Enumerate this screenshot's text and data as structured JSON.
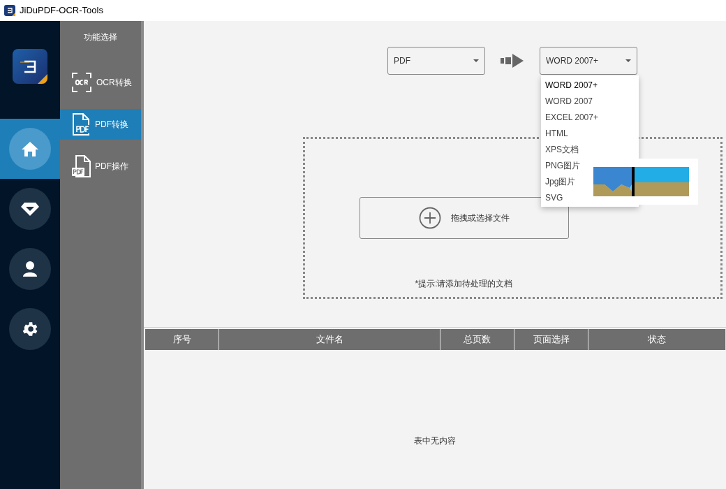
{
  "window": {
    "title": "JiDuPDF-OCR-Tools"
  },
  "nav": [
    {
      "kind": "home",
      "selected": true
    },
    {
      "kind": "diamond",
      "selected": false
    },
    {
      "kind": "user",
      "selected": false
    },
    {
      "kind": "settings",
      "selected": false
    }
  ],
  "sidebar": {
    "title": "功能选择",
    "items": [
      {
        "kind": "ocr",
        "label": "OCR转换",
        "selected": false
      },
      {
        "kind": "pdf",
        "label": "PDF转换",
        "selected": true
      },
      {
        "kind": "pdfdoc",
        "label": "PDF操作",
        "selected": false
      }
    ]
  },
  "source_select": {
    "value": "PDF"
  },
  "target_select": {
    "value": "WORD 2007+",
    "expanded": true,
    "options": [
      {
        "label": "WORD 2007+",
        "selected": true
      },
      {
        "label": "WORD 2007",
        "selected": false
      },
      {
        "label": "EXCEL 2007+",
        "selected": false
      },
      {
        "label": "HTML",
        "selected": false
      },
      {
        "label": "XPS文档",
        "selected": false
      },
      {
        "label": "PNG图片",
        "selected": false
      },
      {
        "label": "Jpg图片",
        "selected": false
      },
      {
        "label": "SVG",
        "selected": false
      }
    ]
  },
  "drop_zone": {
    "button": "拖拽或选择文件",
    "hint": "*提示:请添加待处理的文档"
  },
  "table": {
    "columns": [
      "序号",
      "文件名",
      "总页数",
      "页面选择",
      "状态"
    ],
    "empty_text": "表中无内容"
  }
}
